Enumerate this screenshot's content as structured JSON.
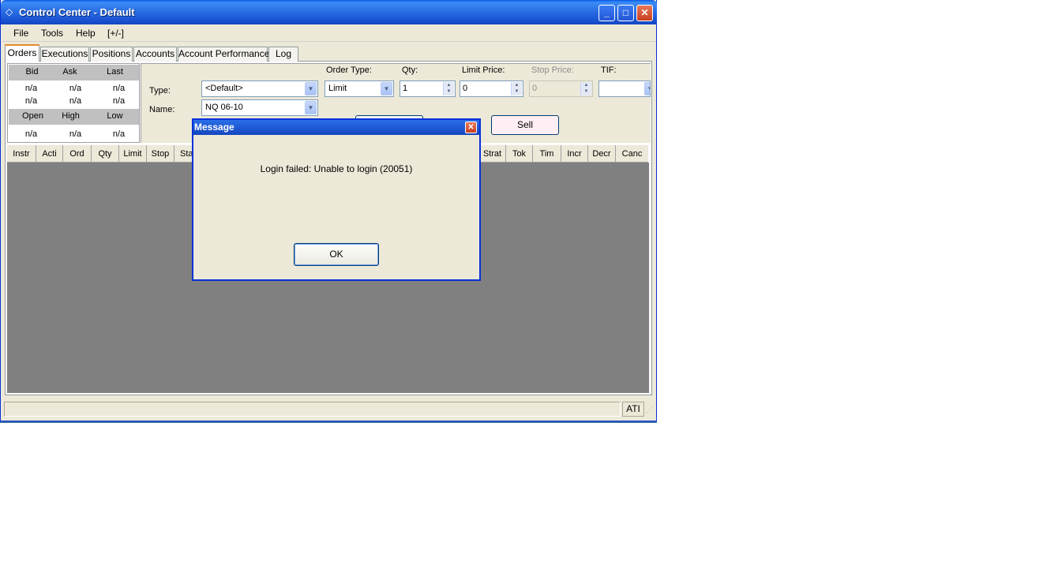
{
  "window": {
    "title": "Control Center - Default",
    "controls": {
      "minimize": "_",
      "maximize": "□",
      "close": "✕"
    }
  },
  "menu": {
    "items": [
      "File",
      "Tools",
      "Help",
      "[+/-]"
    ]
  },
  "tabs": [
    "Orders",
    "Executions",
    "Positions",
    "Accounts",
    "Account Performance",
    "Log"
  ],
  "active_tab": "Orders",
  "quote": {
    "headers1": [
      "Bid",
      "Ask",
      "Last"
    ],
    "row1": [
      "n/a",
      "n/a",
      "n/a"
    ],
    "row2": [
      "n/a",
      "n/a",
      "n/a"
    ],
    "headers2": [
      "Open",
      "High",
      "Low"
    ],
    "row3": [
      "n/a",
      "n/a",
      "n/a"
    ]
  },
  "order_form": {
    "type_label": "Type:",
    "type_value": "<Default>",
    "name_label": "Name:",
    "name_value": "NQ 06-10",
    "order_type_label": "Order Type:",
    "order_type_value": "Limit",
    "qty_label": "Qty:",
    "qty_value": "1",
    "limit_price_label": "Limit Price:",
    "limit_price_value": "0",
    "stop_price_label": "Stop Price:",
    "stop_price_value": "0",
    "tif_label": "TIF:",
    "tif_value": "",
    "sell_label": "Sell"
  },
  "grid": {
    "columns_left": [
      "Instr",
      "Acti",
      "Ord",
      "Qty",
      "Limit",
      "Stop",
      "Sta"
    ],
    "columns_right": [
      "Strat",
      "Tok",
      "Tim",
      "Incr",
      "Decr",
      "Canc"
    ]
  },
  "status": {
    "right_text": "ATI"
  },
  "dialog": {
    "title": "Message",
    "message": "Login failed: Unable to login (20051)",
    "ok_label": "OK"
  },
  "colors": {
    "titlebar": "#1a55d4",
    "window_bg": "#ece9d8",
    "grid_bg": "#808080",
    "sell_bg": "#ffeef3"
  }
}
